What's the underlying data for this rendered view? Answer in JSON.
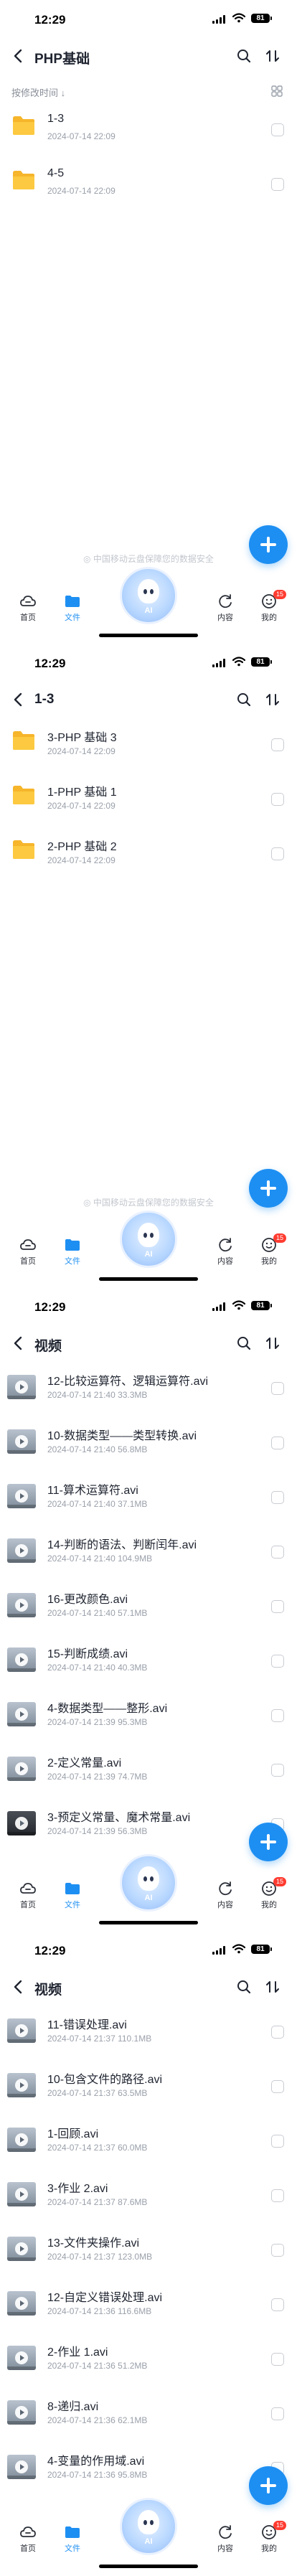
{
  "status": {
    "time": "12:29",
    "battery": "81"
  },
  "sort_label": "按修改时间 ↓",
  "watermark": "中国移动云盘保障您的数据安全",
  "ai_label": "AI",
  "tabs": [
    {
      "label": "首页",
      "icon": "cloud-home-icon"
    },
    {
      "label": "文件",
      "icon": "folder-icon"
    },
    {
      "label": "内容",
      "icon": "refresh-content-icon"
    },
    {
      "label": "我的",
      "icon": "smiley-profile-icon",
      "badge": "15"
    }
  ],
  "screens": [
    {
      "title": "PHP基础",
      "show_sort": true,
      "items": [
        {
          "type": "folder",
          "name": "1-3",
          "meta": "2024-07-14 22:09"
        },
        {
          "type": "folder",
          "name": "4-5",
          "meta": "2024-07-14 22:09"
        }
      ]
    },
    {
      "title": "1-3",
      "show_sort": false,
      "items": [
        {
          "type": "folder",
          "name": "3-PHP 基础 3",
          "meta": "2024-07-14 22:09"
        },
        {
          "type": "folder",
          "name": "1-PHP 基础 1",
          "meta": "2024-07-14 22:09"
        },
        {
          "type": "folder",
          "name": "2-PHP 基础 2",
          "meta": "2024-07-14 22:09"
        }
      ]
    },
    {
      "title": "视频",
      "show_sort": false,
      "items": [
        {
          "type": "video",
          "name": "12-比较运算符、逻辑运算符.avi",
          "meta": "2024-07-14 21:40   33.3MB"
        },
        {
          "type": "video",
          "name": "10-数据类型——类型转换.avi",
          "meta": "2024-07-14 21:40   56.8MB"
        },
        {
          "type": "video",
          "name": "11-算术运算符.avi",
          "meta": "2024-07-14 21:40   37.1MB"
        },
        {
          "type": "video",
          "name": "14-判断的语法、判断闰年.avi",
          "meta": "2024-07-14 21:40   104.9MB"
        },
        {
          "type": "video",
          "name": "16-更改颜色.avi",
          "meta": "2024-07-14 21:40   57.1MB"
        },
        {
          "type": "video",
          "name": "15-判断成绩.avi",
          "meta": "2024-07-14 21:40   40.3MB"
        },
        {
          "type": "video",
          "name": "4-数据类型——整形.avi",
          "meta": "2024-07-14 21:39   95.3MB"
        },
        {
          "type": "video",
          "name": "2-定义常量.avi",
          "meta": "2024-07-14 21:39   74.7MB"
        },
        {
          "type": "video",
          "dark": true,
          "name": "3-预定义常量、魔术常量.avi",
          "meta": "2024-07-14 21:39   56.3MB"
        }
      ]
    },
    {
      "title": "视频",
      "show_sort": false,
      "items": [
        {
          "type": "video",
          "name": "11-错误处理.avi",
          "meta": "2024-07-14 21:37   110.1MB"
        },
        {
          "type": "video",
          "name": "10-包含文件的路径.avi",
          "meta": "2024-07-14 21:37   63.5MB"
        },
        {
          "type": "video",
          "name": "1-回顾.avi",
          "meta": "2024-07-14 21:37   60.0MB"
        },
        {
          "type": "video",
          "name": "3-作业 2.avi",
          "meta": "2024-07-14 21:37   87.6MB"
        },
        {
          "type": "video",
          "name": "13-文件夹操作.avi",
          "meta": "2024-07-14 21:37   123.0MB"
        },
        {
          "type": "video",
          "name": "12-自定义错误处理.avi",
          "meta": "2024-07-14 21:36   116.6MB"
        },
        {
          "type": "video",
          "name": "2-作业 1.avi",
          "meta": "2024-07-14 21:36   51.2MB"
        },
        {
          "type": "video",
          "name": "8-递归.avi",
          "meta": "2024-07-14 21:36   62.1MB"
        },
        {
          "type": "video",
          "name": "4-变量的作用域.avi",
          "meta": "2024-07-14 21:36   95.8MB"
        }
      ]
    }
  ]
}
